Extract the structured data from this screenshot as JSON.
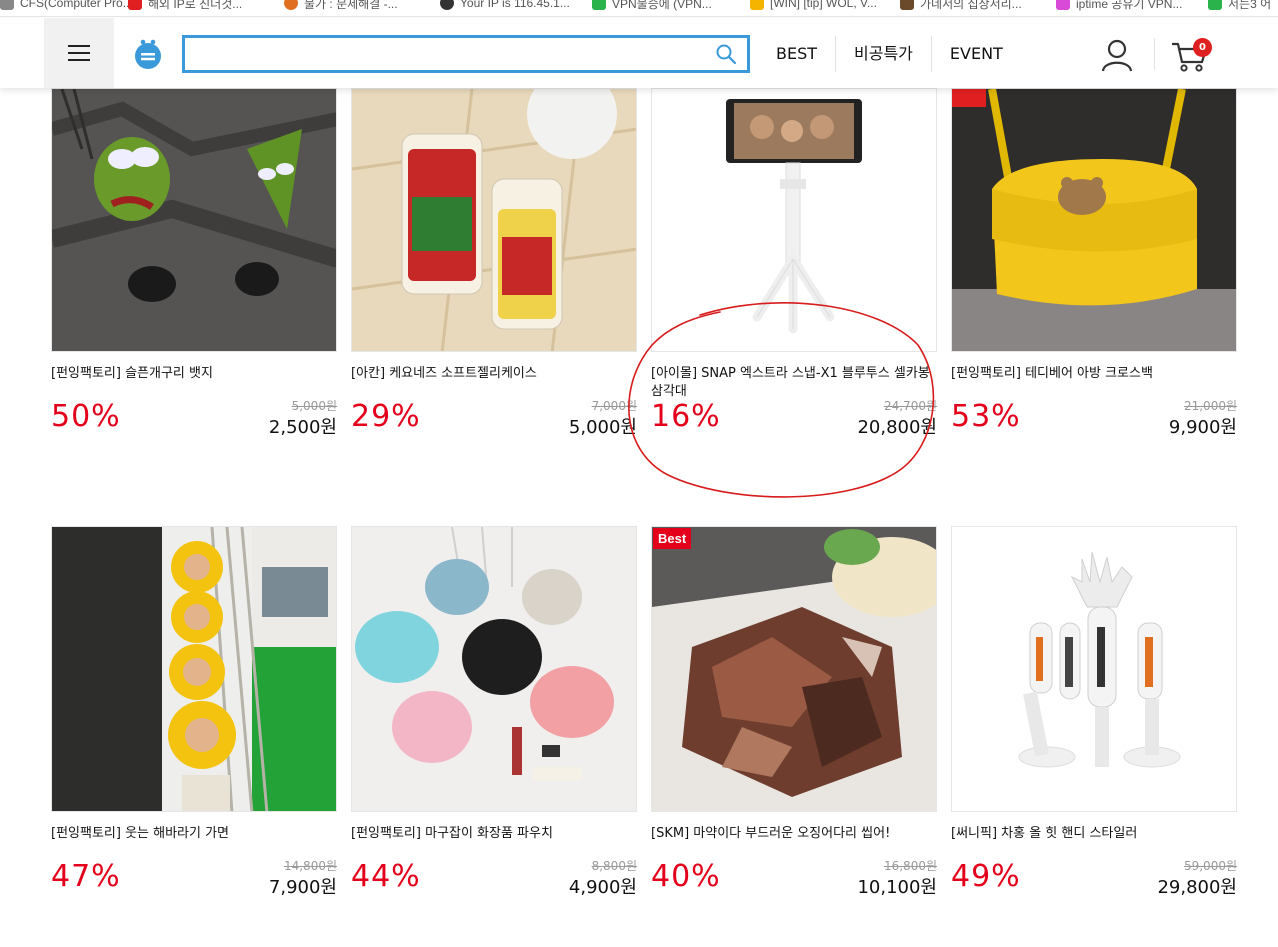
{
  "bookmarks": [
    {
      "label": "CFS(Computer Pro...",
      "color": "#888888"
    },
    {
      "label": "해외 IP로 진더것...",
      "color": "#e02020"
    },
    {
      "label": "불가 : 문제해결 -...",
      "color": "#e07020"
    },
    {
      "label": "Your IP is 116.45.1...",
      "color": "#333333"
    },
    {
      "label": "VPN불승에 (VPN...",
      "color": "#29b34a"
    },
    {
      "label": "[WIN] [tip] WOL, V...",
      "color": "#f4b400"
    },
    {
      "label": "가네서의 집상서리...",
      "color": "#6b4a2b"
    },
    {
      "label": "iptime 공유기 VPN...",
      "color": "#d94ad9"
    },
    {
      "label": "서는3 어",
      "color": "#29b34a"
    }
  ],
  "header": {
    "search_placeholder": "",
    "nav": [
      "BEST",
      "비공특가",
      "EVENT"
    ],
    "cart_count": "0"
  },
  "products": [
    {
      "title": "[펀잉팩토리] 슬픈개구리 뱃지",
      "discount": "50%",
      "original_price": "5,000원",
      "sale_price": "2,500원",
      "badge": ""
    },
    {
      "title": "[아칸] 케요네즈 소프트젤리케이스",
      "discount": "29%",
      "original_price": "7,000원",
      "sale_price": "5,000원",
      "badge": ""
    },
    {
      "title": "[아이몰] SNAP 엑스트라 스냅-X1 블루투스 셀카봉 삼각대",
      "discount": "16%",
      "original_price": "24,700원",
      "sale_price": "20,800원",
      "badge": ""
    },
    {
      "title": "[펀잉팩토리] 테디베어 아방 크로스백",
      "discount": "53%",
      "original_price": "21,000원",
      "sale_price": "9,900원",
      "badge": ""
    },
    {
      "title": "[펀잉팩토리] 웃는 해바라기 가면",
      "discount": "47%",
      "original_price": "14,800원",
      "sale_price": "7,900원",
      "badge": ""
    },
    {
      "title": "[펀잉팩토리] 마구잡이 화장품 파우치",
      "discount": "44%",
      "original_price": "8,800원",
      "sale_price": "4,900원",
      "badge": ""
    },
    {
      "title": "[SKM] 마약이다 부드러운 오징어다리 씹어!",
      "discount": "40%",
      "original_price": "16,800원",
      "sale_price": "10,100원",
      "badge": "Best"
    },
    {
      "title": "[써니픽] 차홍 올 힛 핸디 스타일러",
      "discount": "49%",
      "original_price": "59,000원",
      "sale_price": "29,800원",
      "badge": ""
    }
  ],
  "colors": {
    "accent": "#3a9ad9",
    "discount": "#e4001b",
    "badge": "#e02020",
    "annotation": "#d81b1b"
  }
}
